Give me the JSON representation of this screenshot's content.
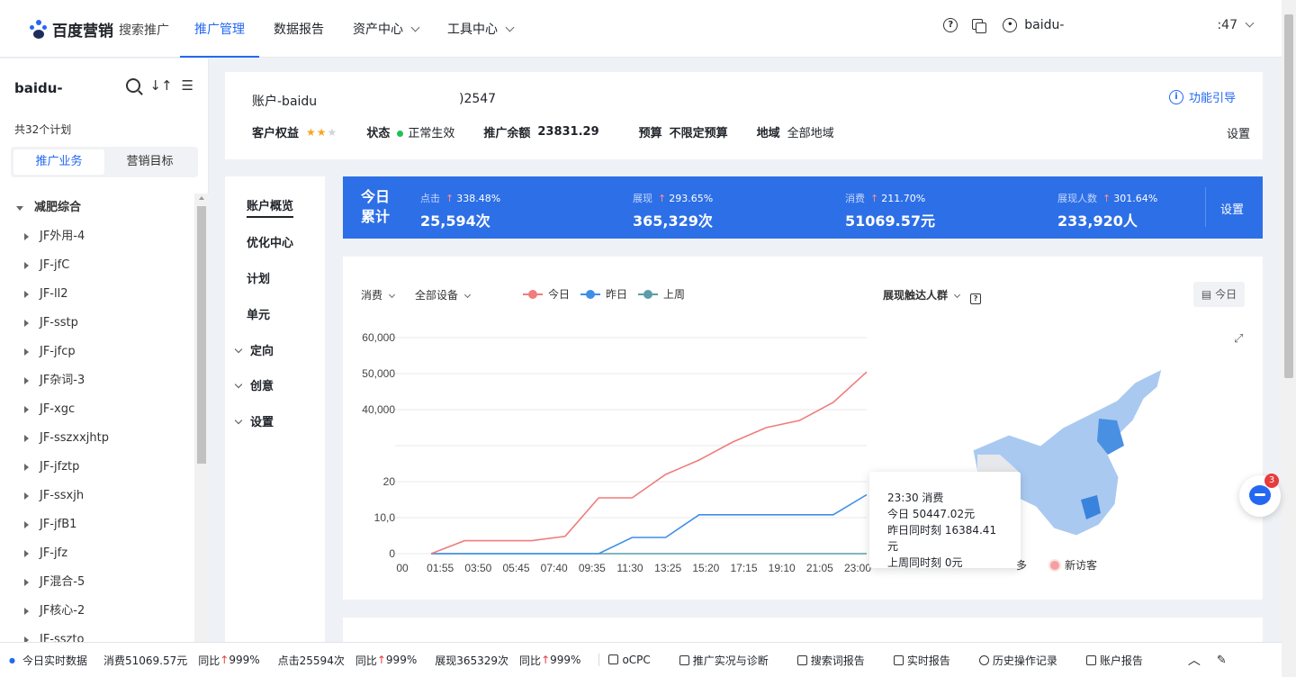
{
  "brand": {
    "name": "百度营销",
    "product": "搜索推广"
  },
  "nav": [
    {
      "label": "推广管理",
      "active": true,
      "dropdown": false
    },
    {
      "label": "数据报告",
      "active": false,
      "dropdown": false
    },
    {
      "label": "资产中心",
      "active": false,
      "dropdown": true
    },
    {
      "label": "工具中心",
      "active": false,
      "dropdown": true
    }
  ],
  "topbar": {
    "help_icon": "question-circle-icon",
    "copy_icon": "copy-icon",
    "user_icon": "user-icon",
    "username": "baidu-",
    "account_tail": ":47"
  },
  "sidebar": {
    "account_name": "baidu-",
    "plan_count": "共32个计划",
    "tabs": [
      {
        "label": "推广业务",
        "active": true
      },
      {
        "label": "营销目标",
        "active": false
      }
    ],
    "tree_root": "减肥综合",
    "tree_items": [
      "JF外用-4",
      "JF-jfC",
      "JF-ll2",
      "JF-sstp",
      "JF-jfcp",
      "JF杂词-3",
      "JF-xgc",
      "JF-sszxxjhtp",
      "JF-jfztp",
      "JF-ssxjh",
      "JF-jfB1",
      "JF-jfz",
      "JF混合-5",
      "JF核心-2",
      "JF-sszto"
    ]
  },
  "account_card": {
    "account_id": "账户-baidu",
    "account_id_tail": ")2547",
    "guide_label": "功能引导",
    "equity_label": "客户权益",
    "stars_filled": 2,
    "stars_total": 3,
    "status_label": "状态",
    "status_value": "正常生效",
    "balance_label": "推广余额",
    "balance_value": "23831.29",
    "budget_label": "预算",
    "budget_value": "不限定预算",
    "region_label": "地域",
    "region_value": "全部地域",
    "setting_label": "设置"
  },
  "menu": [
    {
      "label": "账户概览",
      "active": true,
      "collapsible": false
    },
    {
      "label": "优化中心",
      "active": false,
      "collapsible": false
    },
    {
      "label": "计划",
      "active": false,
      "collapsible": false
    },
    {
      "label": "单元",
      "active": false,
      "collapsible": false
    },
    {
      "label": "定向",
      "active": false,
      "collapsible": true
    },
    {
      "label": "创意",
      "active": false,
      "collapsible": true
    },
    {
      "label": "设置",
      "active": false,
      "collapsible": true
    }
  ],
  "stats": {
    "today_line1": "今日",
    "today_line2": "累计",
    "items": [
      {
        "name": "点击",
        "change": "338.48%",
        "value": "25,594次"
      },
      {
        "name": "展现",
        "change": "293.65%",
        "value": "365,329次"
      },
      {
        "name": "消费",
        "change": "211.70%",
        "value": "51069.57元"
      },
      {
        "name": "展现人数",
        "change": "301.64%",
        "value": "233,920人"
      }
    ],
    "setting_label": "设置"
  },
  "chart_controls": {
    "metric": "消费",
    "device": "全部设备",
    "region_metric": "展现触达人群",
    "date_button": "今日"
  },
  "chart_data": {
    "type": "line",
    "x": [
      "00:00",
      "01:55",
      "03:50",
      "05:45",
      "07:40",
      "09:35",
      "11:30",
      "13:25",
      "15:20",
      "17:15",
      "19:10",
      "21:05",
      "23:00"
    ],
    "ylim": [
      0,
      60000
    ],
    "yticks": [
      "60,000",
      "50,000",
      "40,000",
      "20",
      "10,0",
      "0"
    ],
    "xticks": [
      "00",
      "01:55",
      "03:50",
      "05:45",
      "07:40",
      "09:35",
      "11:30",
      "13:25",
      "15:20",
      "17:15",
      "19:10",
      "21:05",
      "23:00"
    ],
    "series": [
      {
        "name": "今日",
        "color": "#f07c7c",
        "values": [
          0,
          3600,
          3600,
          3600,
          4800,
          15500,
          15500,
          22000,
          26000,
          31000,
          35000,
          37000,
          42000,
          50447
        ]
      },
      {
        "name": "昨日",
        "color": "#3d8fe6",
        "values": [
          0,
          0,
          0,
          0,
          0,
          0,
          4500,
          4500,
          10800,
          10800,
          10800,
          10800,
          10800,
          16384
        ]
      },
      {
        "name": "上周",
        "color": "#5b9ea7",
        "values": [
          0,
          0,
          0,
          0,
          0,
          0,
          0,
          0,
          0,
          0,
          0,
          0,
          0,
          0
        ]
      }
    ]
  },
  "tooltip": {
    "title": "23:30 消费",
    "today": "今日 50447.02元",
    "yesterday": "昨日同时刻 16384.41元",
    "lastweek": "上周同时刻 0元"
  },
  "map_legend": {
    "more": "多",
    "new_visitor": "新访客"
  },
  "chat_badge": "3",
  "bottombar": {
    "realtime_label": "今日实时数据",
    "cost": "消费51069.57元",
    "cost_cmp": "同比",
    "cost_pct": "999%",
    "clicks": "点击25594次",
    "clicks_cmp": "同比",
    "clicks_pct": "999%",
    "impr": "展现365329次",
    "impr_cmp": "同比",
    "impr_pct": "999%",
    "links": [
      "oCPC",
      "推广实况与诊断",
      "搜索词报告",
      "实时报告",
      "历史操作记录",
      "账户报告"
    ]
  }
}
